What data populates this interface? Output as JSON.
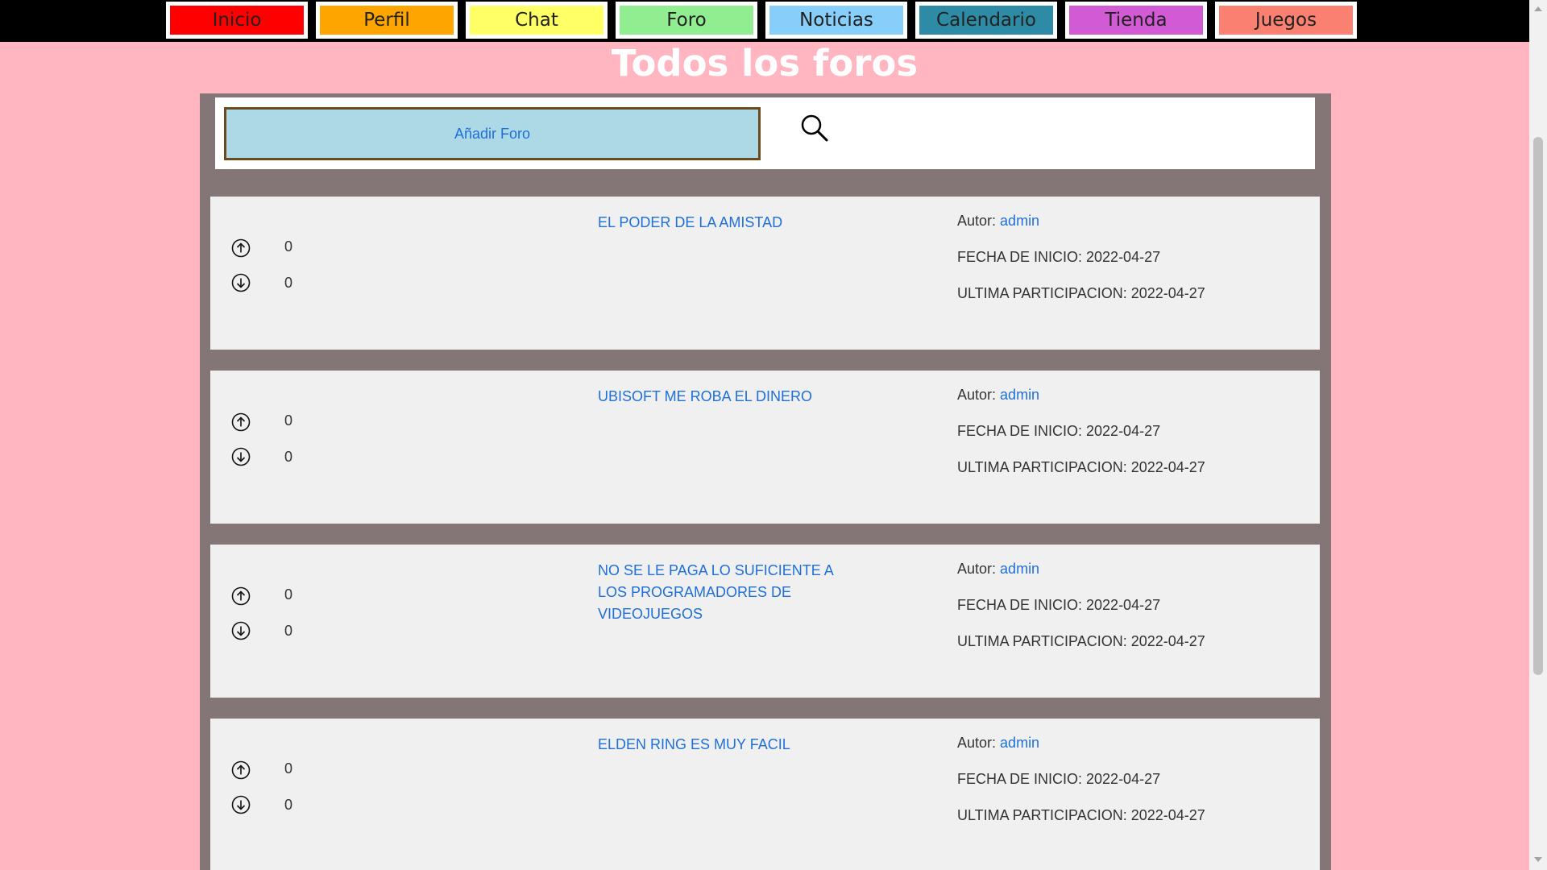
{
  "nav": {
    "items": [
      {
        "label": "Inicio",
        "color": "#ff0000"
      },
      {
        "label": "Perfil",
        "color": "#ffa500"
      },
      {
        "label": "Chat",
        "color": "#ffff66"
      },
      {
        "label": "Foro",
        "color": "#90ee90"
      },
      {
        "label": "Noticias",
        "color": "#87cefa"
      },
      {
        "label": "Calendario",
        "color": "#2e8ba5"
      },
      {
        "label": "Tienda",
        "color": "#d25bd5"
      },
      {
        "label": "Juegos",
        "color": "#fa8072"
      }
    ]
  },
  "page_title": "Todos los foros",
  "toolbar": {
    "add_label": "Añadir Foro",
    "search_icon": "search-icon"
  },
  "author_label": "Autor:",
  "forums": [
    {
      "title": "EL PODER DE LA AMISTAD",
      "up": "0",
      "down": "0",
      "author": "admin",
      "start": "FECHA DE INICIO: 2022-04-27",
      "last": "ULTIMA PARTICIPACION: 2022-04-27"
    },
    {
      "title": "UBISOFT ME ROBA EL DINERO",
      "up": "0",
      "down": "0",
      "author": "admin",
      "start": "FECHA DE INICIO: 2022-04-27",
      "last": "ULTIMA PARTICIPACION: 2022-04-27"
    },
    {
      "title": "NO SE LE PAGA LO SUFICIENTE A LOS PROGRAMADORES DE VIDEOJUEGOS",
      "up": "0",
      "down": "0",
      "author": "admin",
      "start": "FECHA DE INICIO: 2022-04-27",
      "last": "ULTIMA PARTICIPACION: 2022-04-27"
    },
    {
      "title": "ELDEN RING ES MUY FACIL",
      "up": "0",
      "down": "0",
      "author": "admin",
      "start": "FECHA DE INICIO: 2022-04-27",
      "last": "ULTIMA PARTICIPACION: 2022-04-27"
    }
  ],
  "colors": {
    "background": "#ffb6c1",
    "container": "#847576",
    "card": "#f0f0f0",
    "link": "#1e6fd9",
    "add_button": "#add8e6"
  }
}
